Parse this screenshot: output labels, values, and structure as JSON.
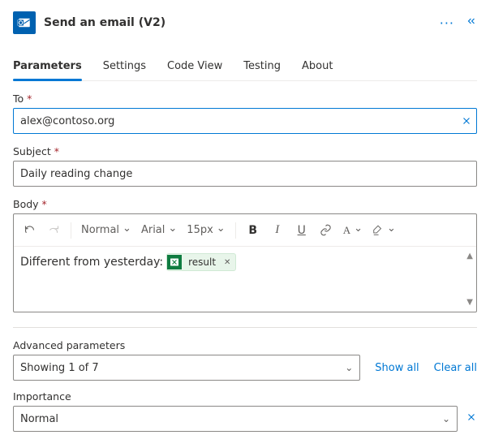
{
  "header": {
    "title": "Send an email (V2)"
  },
  "tabs": {
    "active": 0,
    "items": [
      "Parameters",
      "Settings",
      "Code View",
      "Testing",
      "About"
    ]
  },
  "fields": {
    "to": {
      "label": "To",
      "required": true,
      "value": "alex@contoso.org"
    },
    "subject": {
      "label": "Subject",
      "required": true,
      "value": "Daily reading change"
    },
    "body": {
      "label": "Body",
      "required": true,
      "text_before_token": "Different from yesterday: ",
      "token": {
        "label": "result"
      }
    }
  },
  "toolbar": {
    "style": "Normal",
    "font": "Arial",
    "size": "15px"
  },
  "advanced": {
    "label": "Advanced parameters",
    "summary": "Showing 1 of 7",
    "show_all": "Show all",
    "clear_all": "Clear all"
  },
  "importance": {
    "label": "Importance",
    "value": "Normal"
  }
}
